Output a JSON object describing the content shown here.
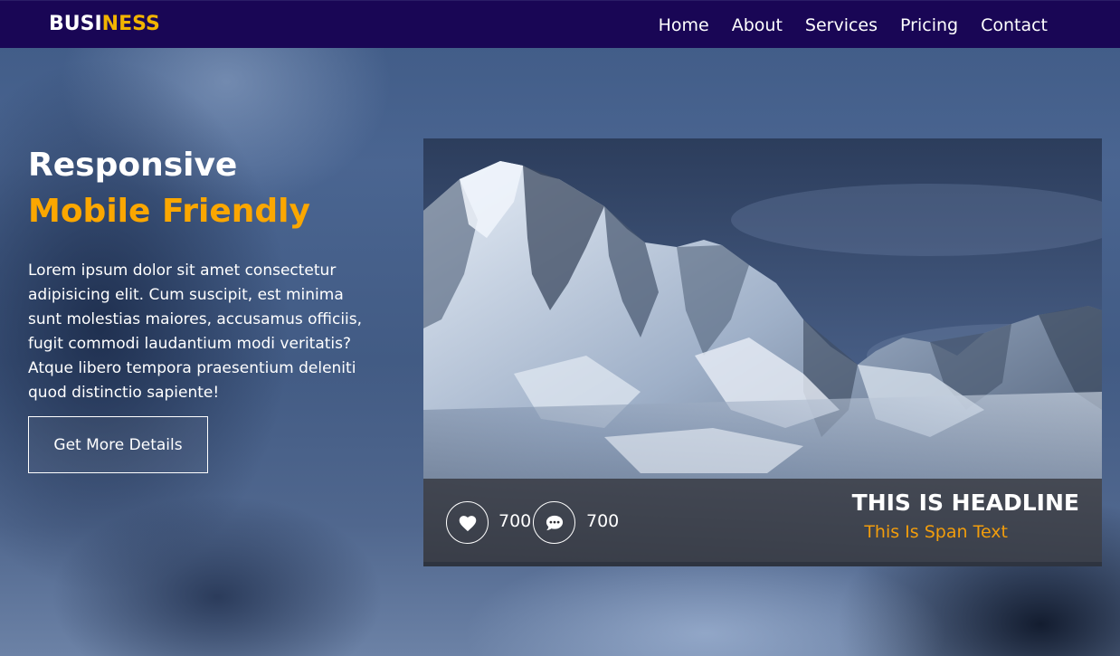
{
  "brand": {
    "part1": "BUSI",
    "part2": "NESS"
  },
  "nav": {
    "items": [
      "Home",
      "About",
      "Services",
      "Pricing",
      "Contact"
    ]
  },
  "hero": {
    "title": "Responsive",
    "subtitle": "Mobile Friendly",
    "paragraph": "Lorem ipsum dolor sit amet consectetur adipisicing elit. Cum suscipit, est minima sunt molestias maiores, accusamus officiis, fugit commodi laudantium modi veritatis? Atque libero tempora praesentium deleniti quod distinctio sapiente!",
    "button_label": "Get More Details"
  },
  "card": {
    "likes": "700",
    "comments": "700",
    "headline": "THIS IS HEADLINE",
    "span_text": "This Is Span Text",
    "like_icon": "heart-icon",
    "comment_icon": "comment-icon"
  },
  "colors": {
    "nav_bg": "#190655",
    "brand_accent": "#f2b400",
    "subtitle": "#fba700",
    "span_text": "#f29d0c"
  }
}
